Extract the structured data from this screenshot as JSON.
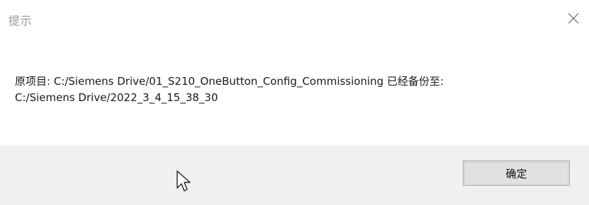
{
  "dialog": {
    "title": "提示",
    "close_symbol": "×",
    "message_line1": "原项目: C:/Siemens Drive/01_S210_OneButton_Config_Commissioning 已经备份至:",
    "message_line2": "C:/Siemens Drive/2022_3_4_15_38_30",
    "ok_label": "确定"
  },
  "icons": {
    "close": "close-icon",
    "cursor": "mouse-pointer-icon"
  },
  "colors": {
    "title_text": "#9a9a9a",
    "footer_bg": "#f0f0f0",
    "button_bg": "#e1e1e1",
    "button_border": "#adadad"
  }
}
